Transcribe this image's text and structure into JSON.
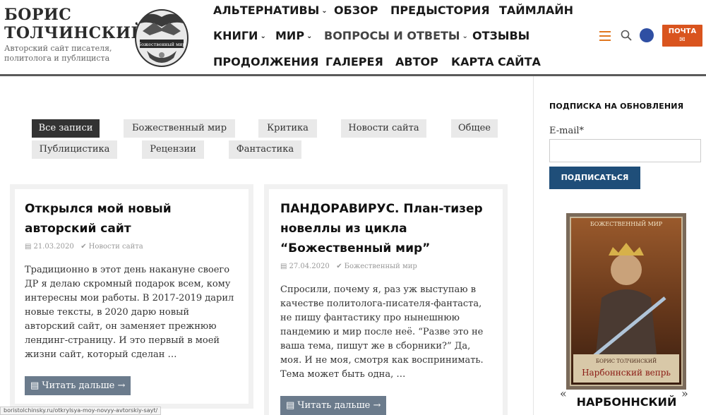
{
  "header": {
    "title_line1": "БОРИС",
    "title_line2": "ТОЛЧИНСКИЙ",
    "tagline_line1": "Авторский сайт писателя,",
    "tagline_line2": "политолога и публициста",
    "logo_text": "Божественный мир",
    "nav": [
      {
        "label": "АЛЬТЕРНАТИВЫ",
        "has_dropdown": true
      },
      {
        "label": "ОБЗОР",
        "has_dropdown": false
      },
      {
        "label": "ПРЕДЫСТОРИЯ",
        "has_dropdown": false
      },
      {
        "label": "ТАЙМЛАЙН",
        "has_dropdown": false
      },
      {
        "label": "КНИГИ",
        "has_dropdown": true
      },
      {
        "label": "МИР",
        "has_dropdown": true
      },
      {
        "label": "ВОПРОСЫ И ОТВЕТЫ",
        "has_dropdown": true
      },
      {
        "label": "ОТЗЫВЫ",
        "has_dropdown": false
      },
      {
        "label": "ПРОДОЛЖЕНИЯ",
        "has_dropdown": false
      },
      {
        "label": "ГАЛЕРЕЯ",
        "has_dropdown": false
      },
      {
        "label": "АВТОР",
        "has_dropdown": false
      },
      {
        "label": "КАРТА САЙТА",
        "has_dropdown": false
      }
    ],
    "caret": "⌄",
    "mail_label": "ПОЧТА",
    "mail_icon": "✉",
    "colors": {
      "accent": "#d9541e",
      "avatar": "#2f4fa3",
      "hamburger": "#e0771f"
    }
  },
  "filters": [
    {
      "label": "Все записи",
      "active": true
    },
    {
      "label": "Божественный мир",
      "active": false
    },
    {
      "label": "Критика",
      "active": false
    },
    {
      "label": "Новости сайта",
      "active": false
    },
    {
      "label": "Общее",
      "active": false
    },
    {
      "label": "Публицистика",
      "active": false
    },
    {
      "label": "Рецензии",
      "active": false
    },
    {
      "label": "Фантастика",
      "active": false
    }
  ],
  "posts": [
    {
      "title": "Открылся мой новый авторский сайт",
      "date": "21.03.2020",
      "category": "Новости сайта",
      "excerpt": "Традиционно в этот день накануне своего ДР я делаю скромный подарок всем, кому интересны мои работы. В 2017-2019 дарил новые тексты, в 2020 дарю новый авторский сайт, он заменяет прежнюю лендинг-страницу. И это первый в моей жизни сайт, который сделан …",
      "read_more": "Читать дальше →"
    },
    {
      "title": "ПАНДОРАВИРУС. План-тизер новеллы из цикла “Божественный мир”",
      "date": "27.04.2020",
      "category": "Божественный мир",
      "excerpt": "Спросили, почему я, раз уж выступаю в качестве политолога-писателя-фантаста, не пишу фантастику про нынешнюю пандемию и мир после неё. “Разве это не ваша тема, пишут же в сборники?” Да, моя. И не моя, смотря как воспринимать. Тема может быть одна, …",
      "read_more": "Читать дальше →"
    }
  ],
  "icons": {
    "calendar": "calendar-icon",
    "category": "check-circle-icon",
    "read_more": "list-icon"
  },
  "sidebar": {
    "subscribe_title": "ПОДПИСКА НА ОБНОВЛЕНИЯ",
    "email_label": "E-mail*",
    "email_value": "",
    "subscribe_button": "ПОДПИСАТЬСЯ",
    "book_series": "БОЖЕСТВЕННЫЙ МИР",
    "book_author": "БОРИС ТОЛЧИНСКИЙ",
    "book_title": "Нарбоннский вепрь",
    "book_caption": "НАРБОННСКИЙ",
    "prev": "«",
    "next": "»"
  },
  "status_bar_url": "boristolchinsky.ru/otkrylsya-moy-novyy-avtorskiy-sayt/"
}
